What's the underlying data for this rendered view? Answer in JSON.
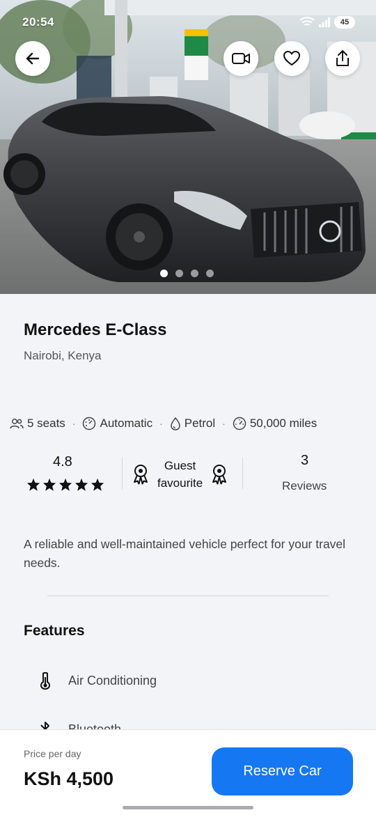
{
  "status_bar": {
    "time": "20:54",
    "battery": "45"
  },
  "hero": {
    "image_count": 4,
    "active_index": 0
  },
  "car": {
    "title": "Mercedes E-Class",
    "location": "Nairobi, Kenya"
  },
  "specs": [
    {
      "icon": "people-icon",
      "label": "5 seats"
    },
    {
      "icon": "gearbox-icon",
      "label": "Automatic"
    },
    {
      "icon": "fuel-drop-icon",
      "label": "Petrol"
    },
    {
      "icon": "speedometer-icon",
      "label": "50,000 miles"
    }
  ],
  "stats": {
    "rating": "4.8",
    "stars": 5,
    "guest_favourite_line1": "Guest",
    "guest_favourite_line2": "favourite",
    "reviews_count": "3",
    "reviews_label": "Reviews"
  },
  "description": "A reliable and well-maintained vehicle perfect for your travel needs.",
  "features": {
    "title": "Features",
    "items": [
      {
        "icon": "thermometer-icon",
        "label": "Air Conditioning"
      },
      {
        "icon": "bluetooth-icon",
        "label": "Bluetooth"
      }
    ]
  },
  "footer": {
    "price_label": "Price per day",
    "price": "KSh 4,500",
    "reserve_label": "Reserve Car"
  },
  "colors": {
    "accent": "#1677f2",
    "background": "#f3f4f8"
  }
}
